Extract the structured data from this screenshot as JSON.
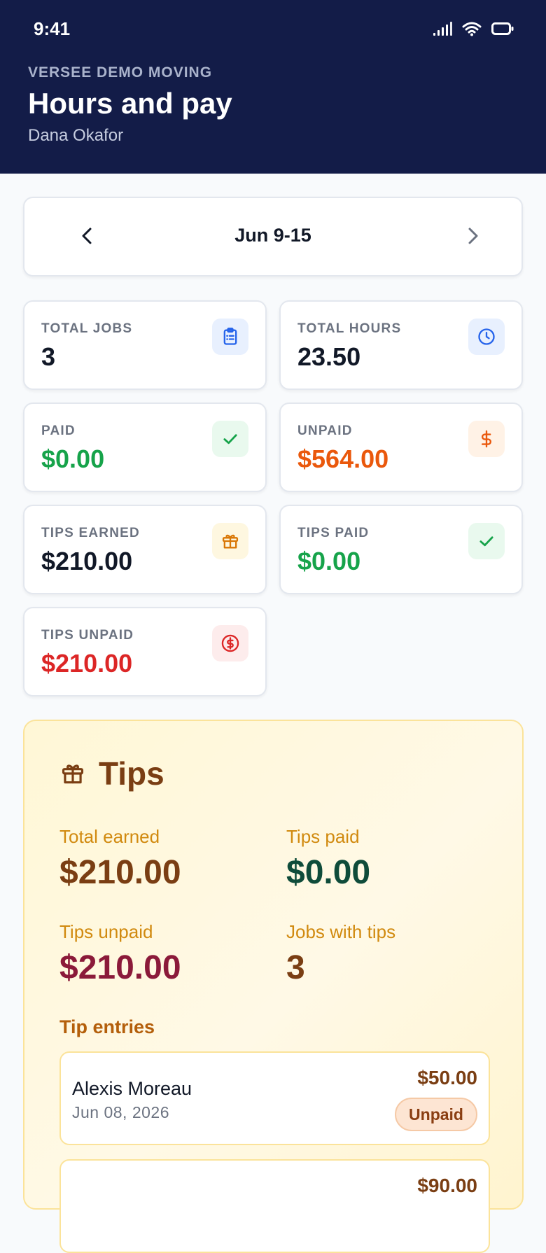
{
  "status_bar": {
    "time": "9:41"
  },
  "header": {
    "org": "VERSEE DEMO MOVING",
    "title": "Hours and pay",
    "user": "Dana Okafor"
  },
  "week_nav": {
    "label": "Jun 9-15"
  },
  "stats": {
    "total_jobs": {
      "label": "TOTAL JOBS",
      "value": "3",
      "icon": "clipboard-icon"
    },
    "total_hours": {
      "label": "TOTAL HOURS",
      "value": "23.50",
      "icon": "clock-icon"
    },
    "paid": {
      "label": "PAID",
      "value": "$0.00",
      "icon": "check-icon"
    },
    "unpaid": {
      "label": "UNPAID",
      "value": "$564.00",
      "icon": "dollar-icon"
    },
    "tips_earned": {
      "label": "TIPS EARNED",
      "value": "$210.00",
      "icon": "gift-icon"
    },
    "tips_paid": {
      "label": "TIPS PAID",
      "value": "$0.00",
      "icon": "check-icon"
    },
    "tips_unpaid": {
      "label": "TIPS UNPAID",
      "value": "$210.00",
      "icon": "dollar-circle-icon"
    }
  },
  "colors": {
    "header_bg": "#131c48",
    "green": "#16a34a",
    "orange": "#ea580c",
    "red": "#dc2626",
    "tips_brown": "#7a3e13",
    "tips_teal": "#0f4c3a",
    "tips_maroon": "#8b1a3a"
  },
  "tips": {
    "title": "Tips",
    "total_earned": {
      "label": "Total earned",
      "value": "$210.00"
    },
    "tips_paid": {
      "label": "Tips paid",
      "value": "$0.00"
    },
    "tips_unpaid": {
      "label": "Tips unpaid",
      "value": "$210.00"
    },
    "jobs_with_tips": {
      "label": "Jobs with tips",
      "value": "3"
    },
    "entries_label": "Tip entries",
    "entries": [
      {
        "name": "Alexis Moreau",
        "date": "Jun 08, 2026",
        "amount": "$50.00",
        "status": "Unpaid"
      },
      {
        "name": "",
        "date": "",
        "amount": "$90.00",
        "status": ""
      }
    ]
  }
}
